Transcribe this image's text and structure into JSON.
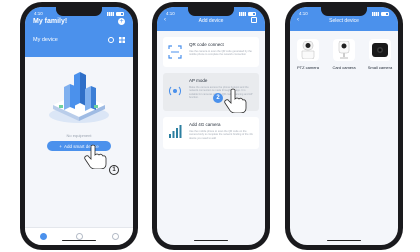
{
  "phone1": {
    "status": {
      "time": "4:10"
    },
    "app_title": "My family!",
    "subtitle": "My device",
    "empty_text": "No equipment",
    "add_button": "Add smart device",
    "step": "1",
    "tabs": [
      "home-icon",
      "scene-icon",
      "profile-icon"
    ]
  },
  "phone2": {
    "status": {
      "time": "4:10"
    },
    "header_title": "Add device",
    "cards": [
      {
        "title": "QR code connect",
        "desc": "Use the camera to scan the QR code generated by the mobile phone to complete the network connection"
      },
      {
        "title": "AP mode",
        "desc": "Make the camera access the phone hotspot and the network connection is made through the app. It is suitable for cameras without QR code scanning and AP function."
      },
      {
        "title": "Add 4G camera",
        "desc": "Use the mobile phone to scan the QR code on the camera body to complete the network binding of the 4G device you need to add"
      }
    ],
    "step": "2"
  },
  "phone3": {
    "status": {
      "time": "4:10"
    },
    "header_title": "Select device",
    "devices": [
      "PTZ camera",
      "Card camera",
      "Small camera"
    ]
  },
  "colors": {
    "accent": "#4b91ec",
    "background": "#f4f6fa",
    "phone_frame": "#1a1a1d"
  }
}
